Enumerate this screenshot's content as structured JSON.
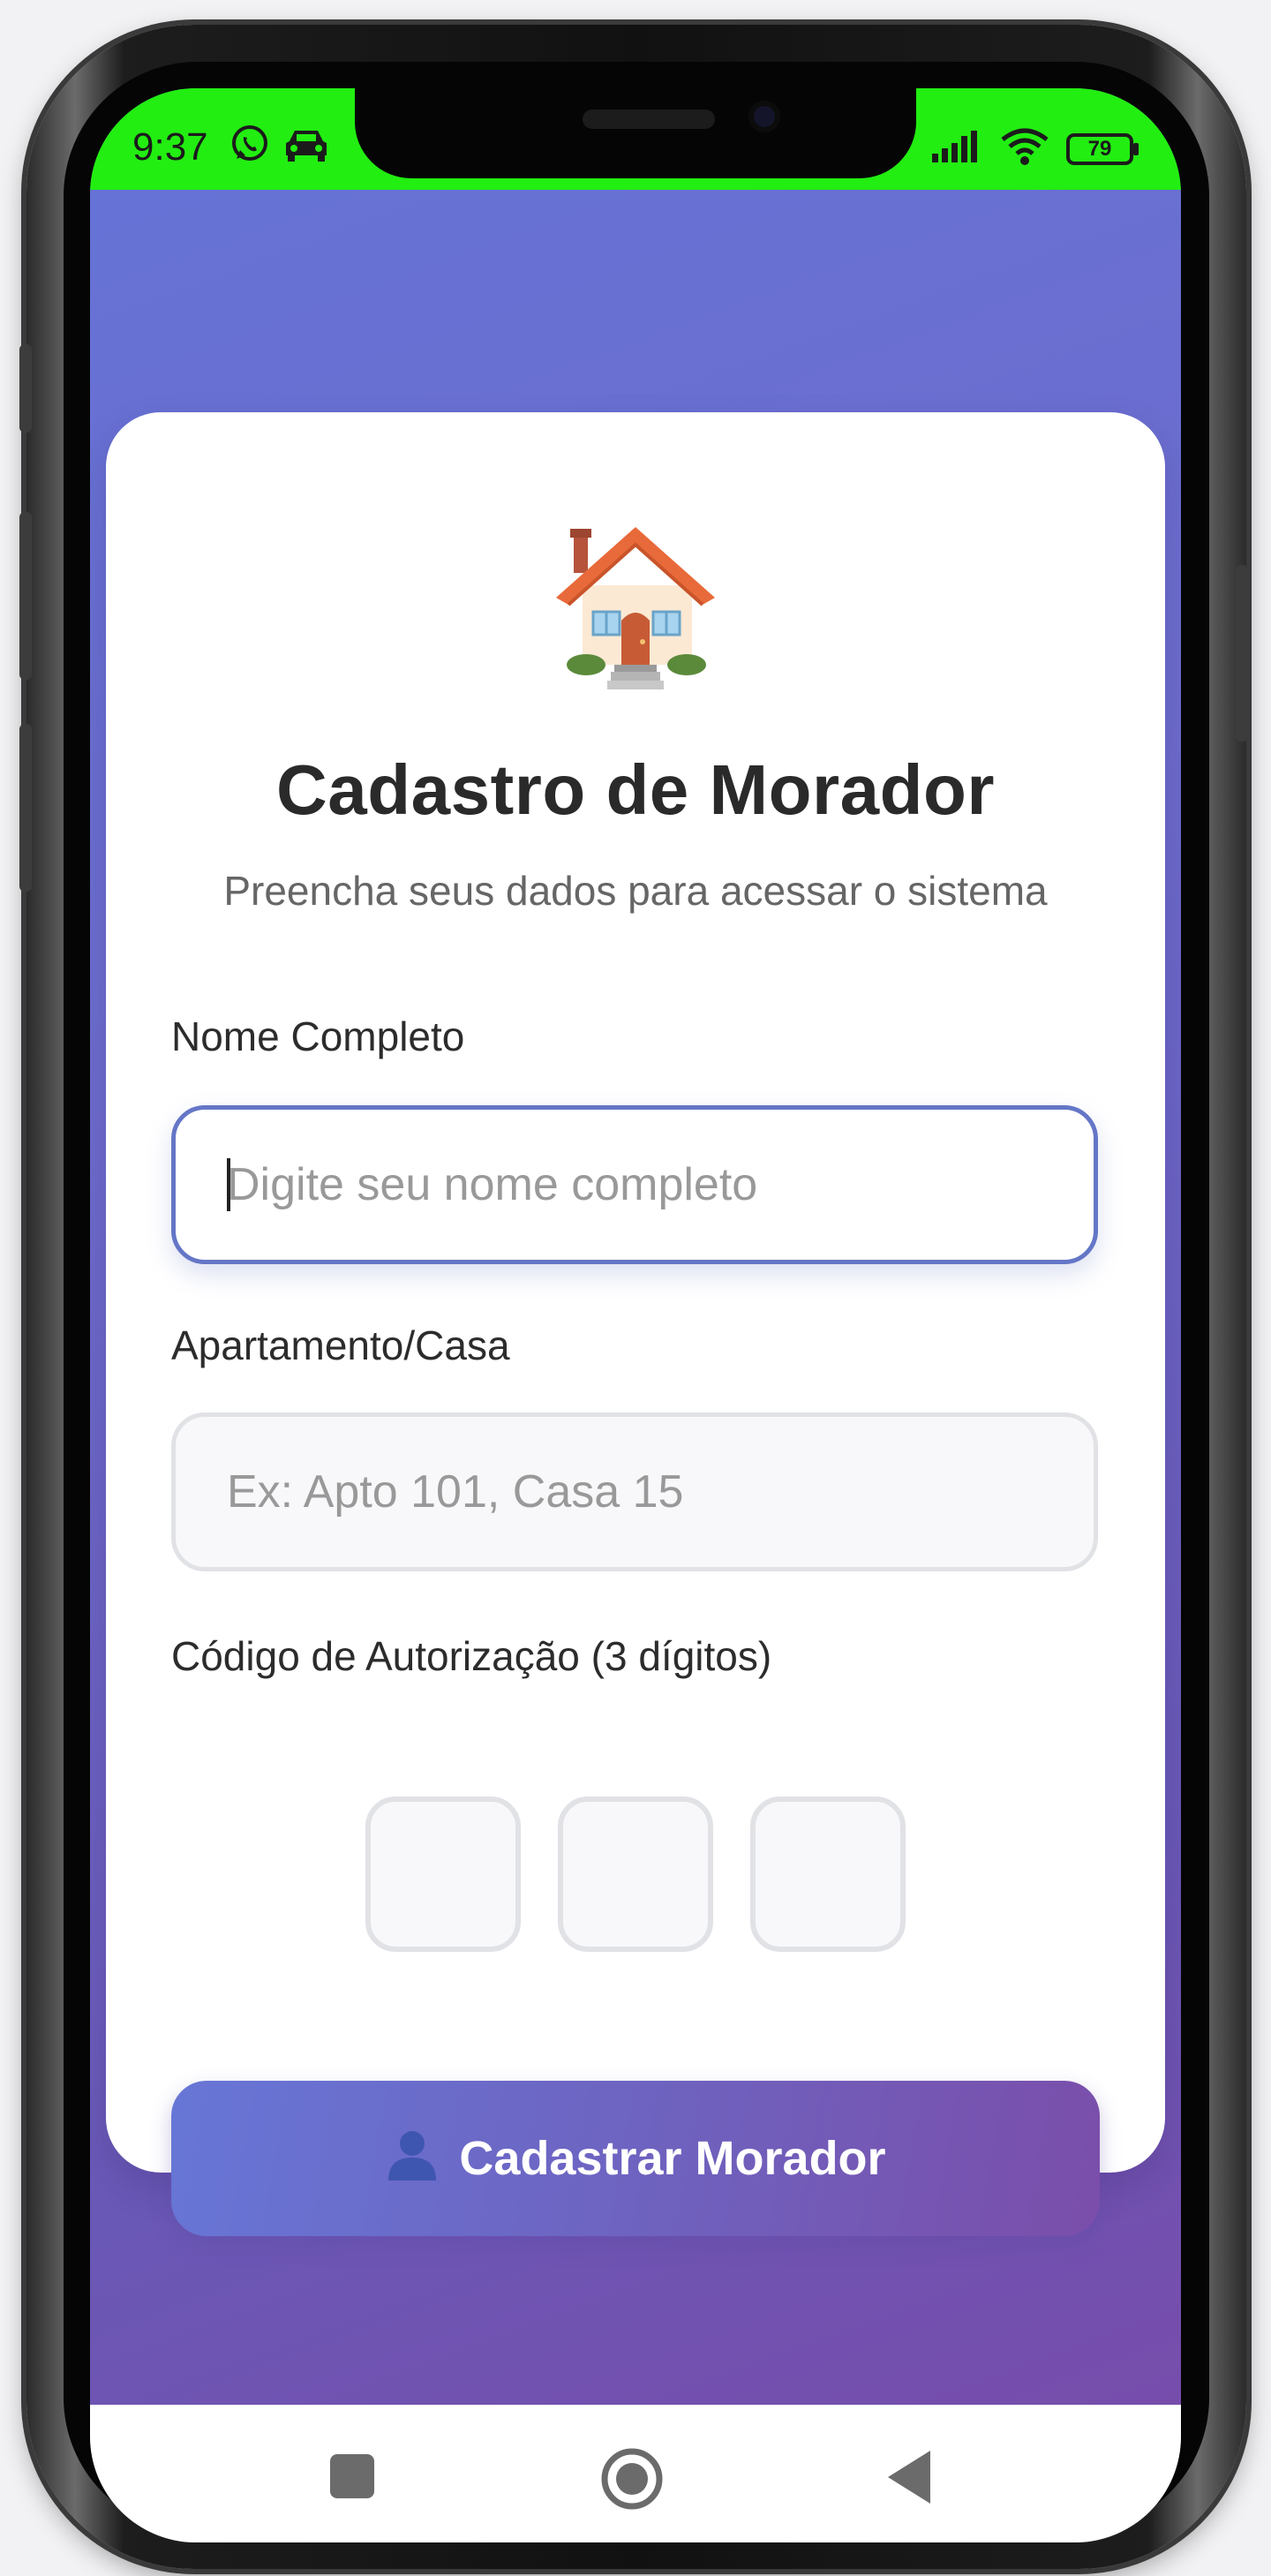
{
  "status_bar": {
    "time": "9:37",
    "battery": "79",
    "bg_color": "#22ee11"
  },
  "icons": {
    "whatsapp": "whatsapp-icon",
    "car": "car-icon",
    "signal": "signal-icon",
    "wifi": "wifi-icon",
    "battery": "battery-icon",
    "house": "house-icon",
    "user": "user-icon",
    "nav_recents": "square-icon",
    "nav_home": "circle-icon",
    "nav_back": "triangle-back-icon"
  },
  "form": {
    "title": "Cadastro de Morador",
    "subtitle": "Preencha seus dados para acessar o sistema",
    "name": {
      "label": "Nome Completo",
      "placeholder": "Digite seu nome completo",
      "value": ""
    },
    "unit": {
      "label": "Apartamento/Casa",
      "placeholder": "Ex: Apto 101, Casa 15",
      "value": ""
    },
    "code": {
      "label": "Código de Autorização (3 dígitos)",
      "digits": [
        "",
        "",
        ""
      ]
    },
    "submit_label": "Cadastrar Morador"
  },
  "colors": {
    "gradient_start": "#6573d6",
    "gradient_end": "#7a4aa9",
    "focus_border": "#6476c6"
  }
}
